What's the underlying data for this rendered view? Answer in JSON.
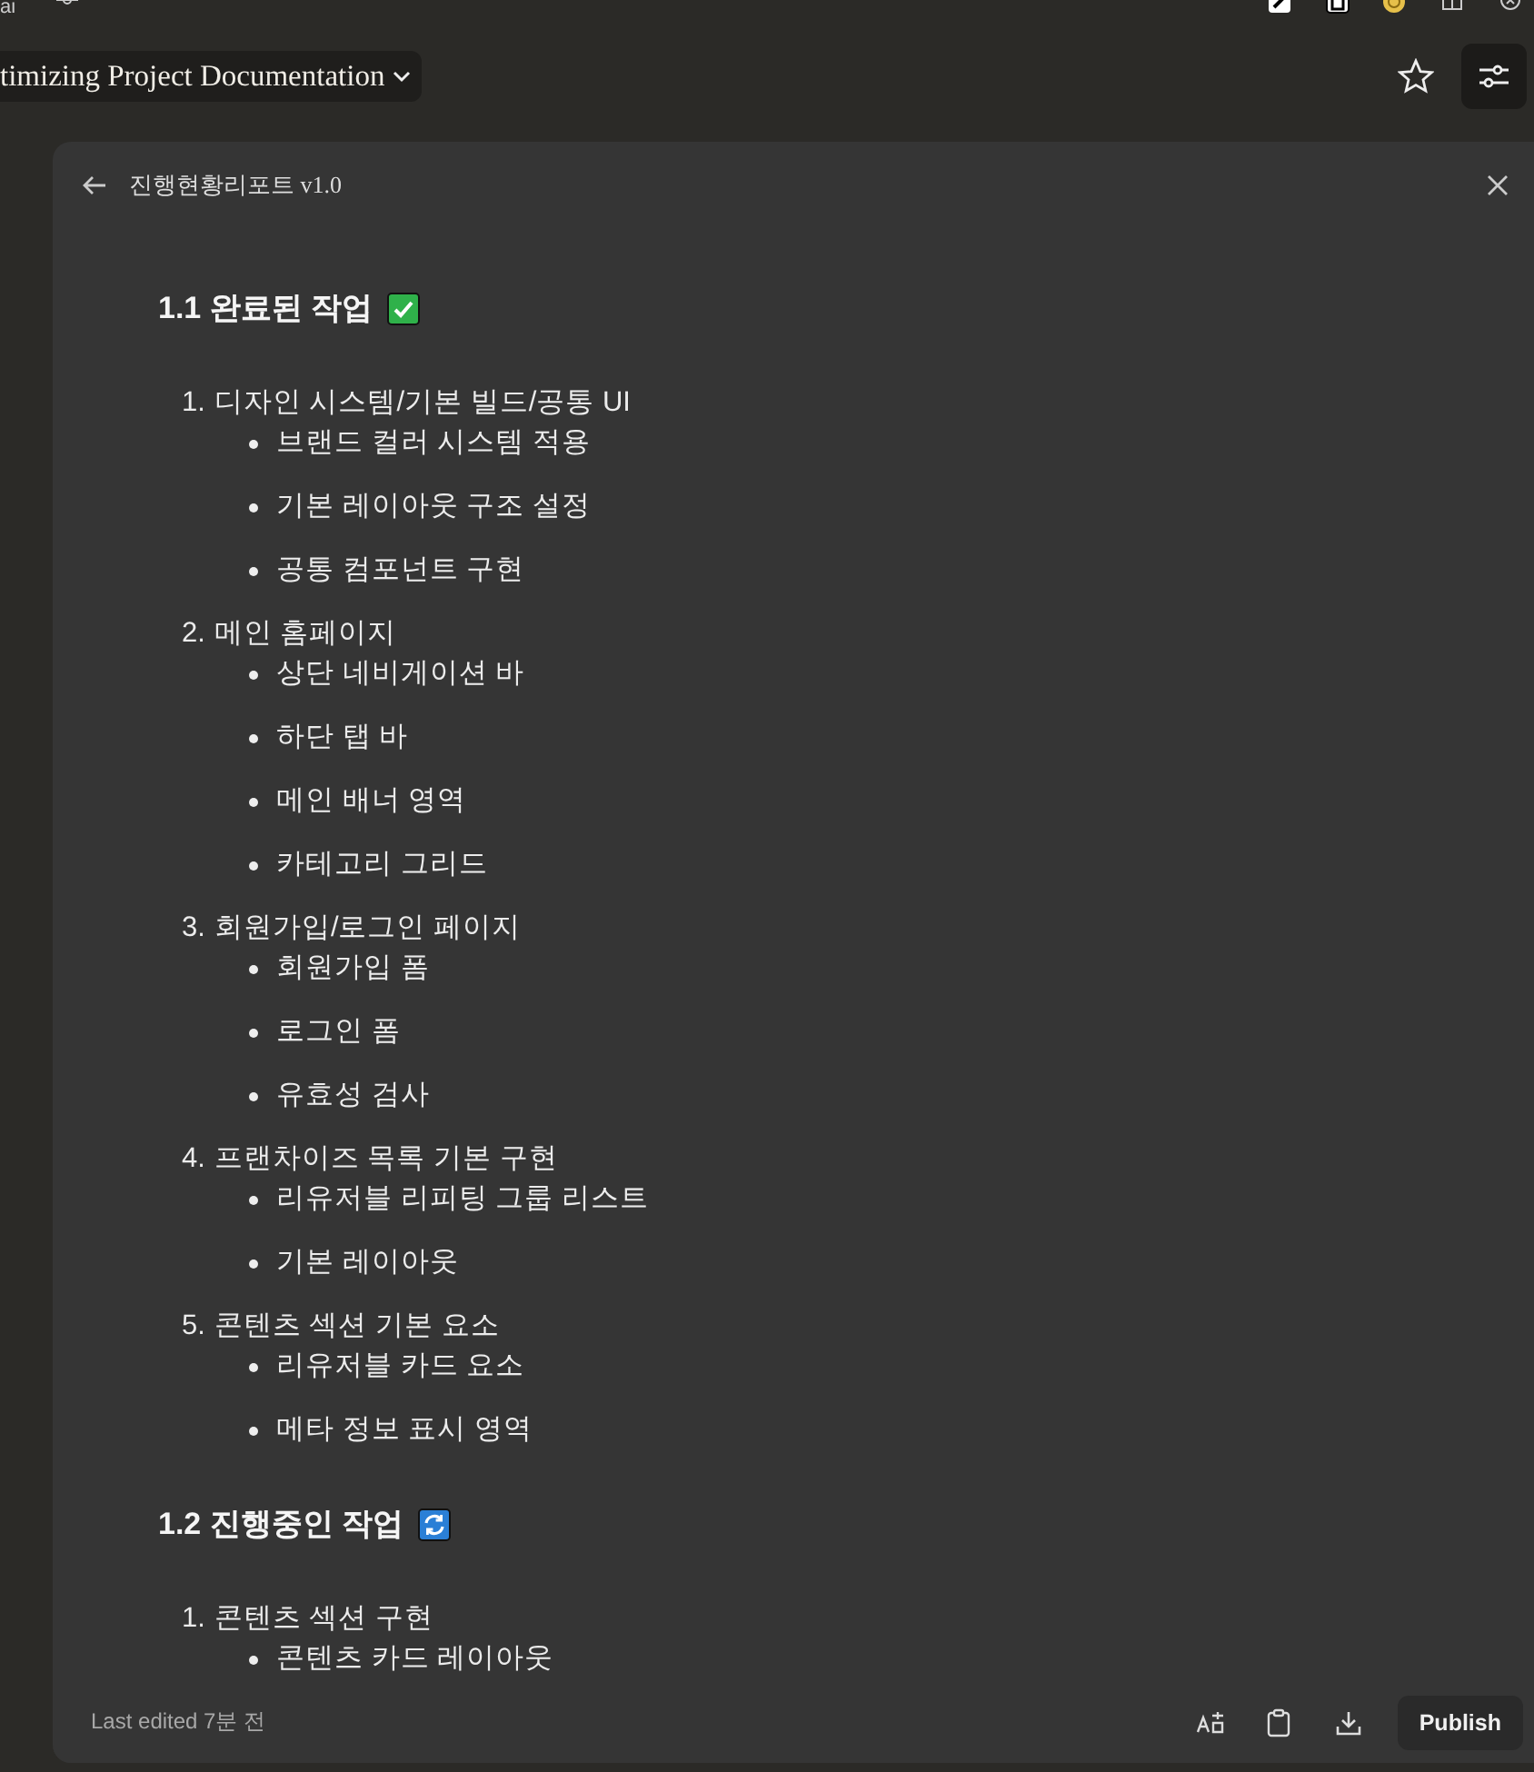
{
  "topbar": {
    "text": "ai"
  },
  "header": {
    "title": "timizing Project Documentation"
  },
  "document": {
    "title": "진행현황리포트 v1.0",
    "sections": [
      {
        "heading": "1.1 완료된 작업",
        "kind": "done",
        "items": [
          {
            "number": "1.",
            "label": "디자인 시스템/기본 빌드/공통 UI",
            "children": [
              "브랜드 컬러 시스템 적용",
              "기본 레이아웃 구조 설정",
              "공통 컴포넌트 구현"
            ]
          },
          {
            "number": "2.",
            "label": "메인 홈페이지",
            "children": [
              "상단 네비게이션 바",
              "하단 탭 바",
              "메인 배너 영역",
              "카테고리 그리드"
            ]
          },
          {
            "number": "3.",
            "label": "회원가입/로그인 페이지",
            "children": [
              "회원가입 폼",
              "로그인 폼",
              "유효성 검사"
            ]
          },
          {
            "number": "4.",
            "label": "프랜차이즈 목록 기본 구현",
            "children": [
              "리유저블 리피팅 그룹 리스트",
              "기본 레이아웃"
            ]
          },
          {
            "number": "5.",
            "label": "콘텐츠 섹션 기본 요소",
            "children": [
              "리유저블 카드 요소",
              "메타 정보 표시 영역"
            ]
          }
        ]
      },
      {
        "heading": "1.2 진행중인 작업",
        "kind": "in_progress",
        "items": [
          {
            "number": "1.",
            "label": "콘텐츠 섹션 구현",
            "children": [
              "콘텐츠 카드 레이아웃"
            ]
          }
        ]
      }
    ]
  },
  "footer": {
    "edited": "Last edited 7분 전",
    "publish": "Publish"
  }
}
